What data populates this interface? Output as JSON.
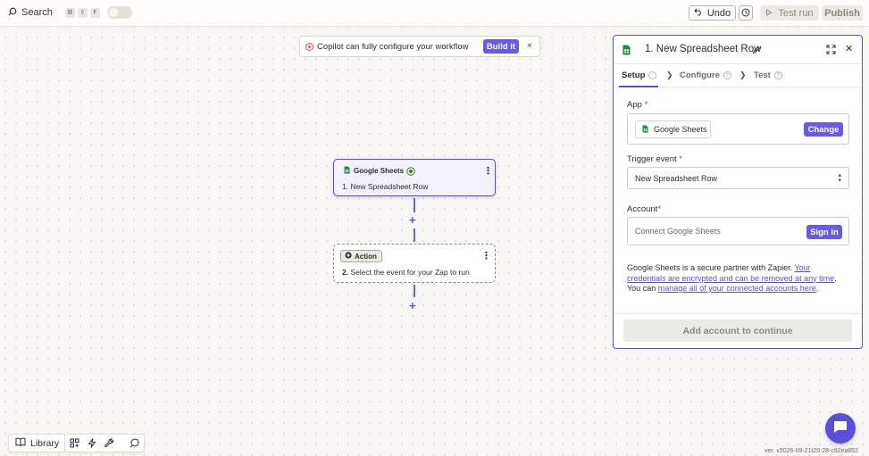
{
  "topbar": {
    "search_label": "Search",
    "shortcut_keys": [
      "⌘",
      "⇧",
      "F"
    ],
    "undo_label": "Undo",
    "test_run_label": "Test run",
    "publish_label": "Publish"
  },
  "copilot": {
    "message": "Copilot can fully configure your workflow",
    "build_label": "Build it",
    "close": "×"
  },
  "canvas": {
    "trigger_node": {
      "app_name": "Google Sheets",
      "title": "1. New Spreadsheet Row"
    },
    "action_node": {
      "badge": "Action",
      "step_number": "2.",
      "title": "Select the event for your Zap to run"
    },
    "add_step": "+"
  },
  "panel": {
    "title": "1. New Spreadsheet Row",
    "tabs": [
      {
        "label": "Setup"
      },
      {
        "label": "Configure"
      },
      {
        "label": "Test"
      }
    ],
    "app_label": "App",
    "required_mark": "*",
    "app_value": "Google Sheets",
    "change_label": "Change",
    "trigger_label": "Trigger event",
    "trigger_value": "New Spreadsheet Row",
    "account_label": "Account",
    "account_placeholder": "Connect Google Sheets",
    "sign_in_label": "Sign in",
    "info_text_1": "Google Sheets is a secure partner with Zapier. ",
    "info_link_1": "Your credentials are encrypted and can be removed at any time",
    "info_text_2": ". You can ",
    "info_link_2": "manage all of your connected accounts here",
    "info_text_3": ".",
    "continue_label": "Add account to continue"
  },
  "bottom": {
    "library_label": "Library"
  },
  "version": "ver. v2026-09-21t20:28-c92ea852",
  "colors": {
    "accent": "#695be8",
    "accent_border": "#5b4fd8",
    "sheets_green": "#1e8e3e",
    "required": "#d0353f"
  }
}
